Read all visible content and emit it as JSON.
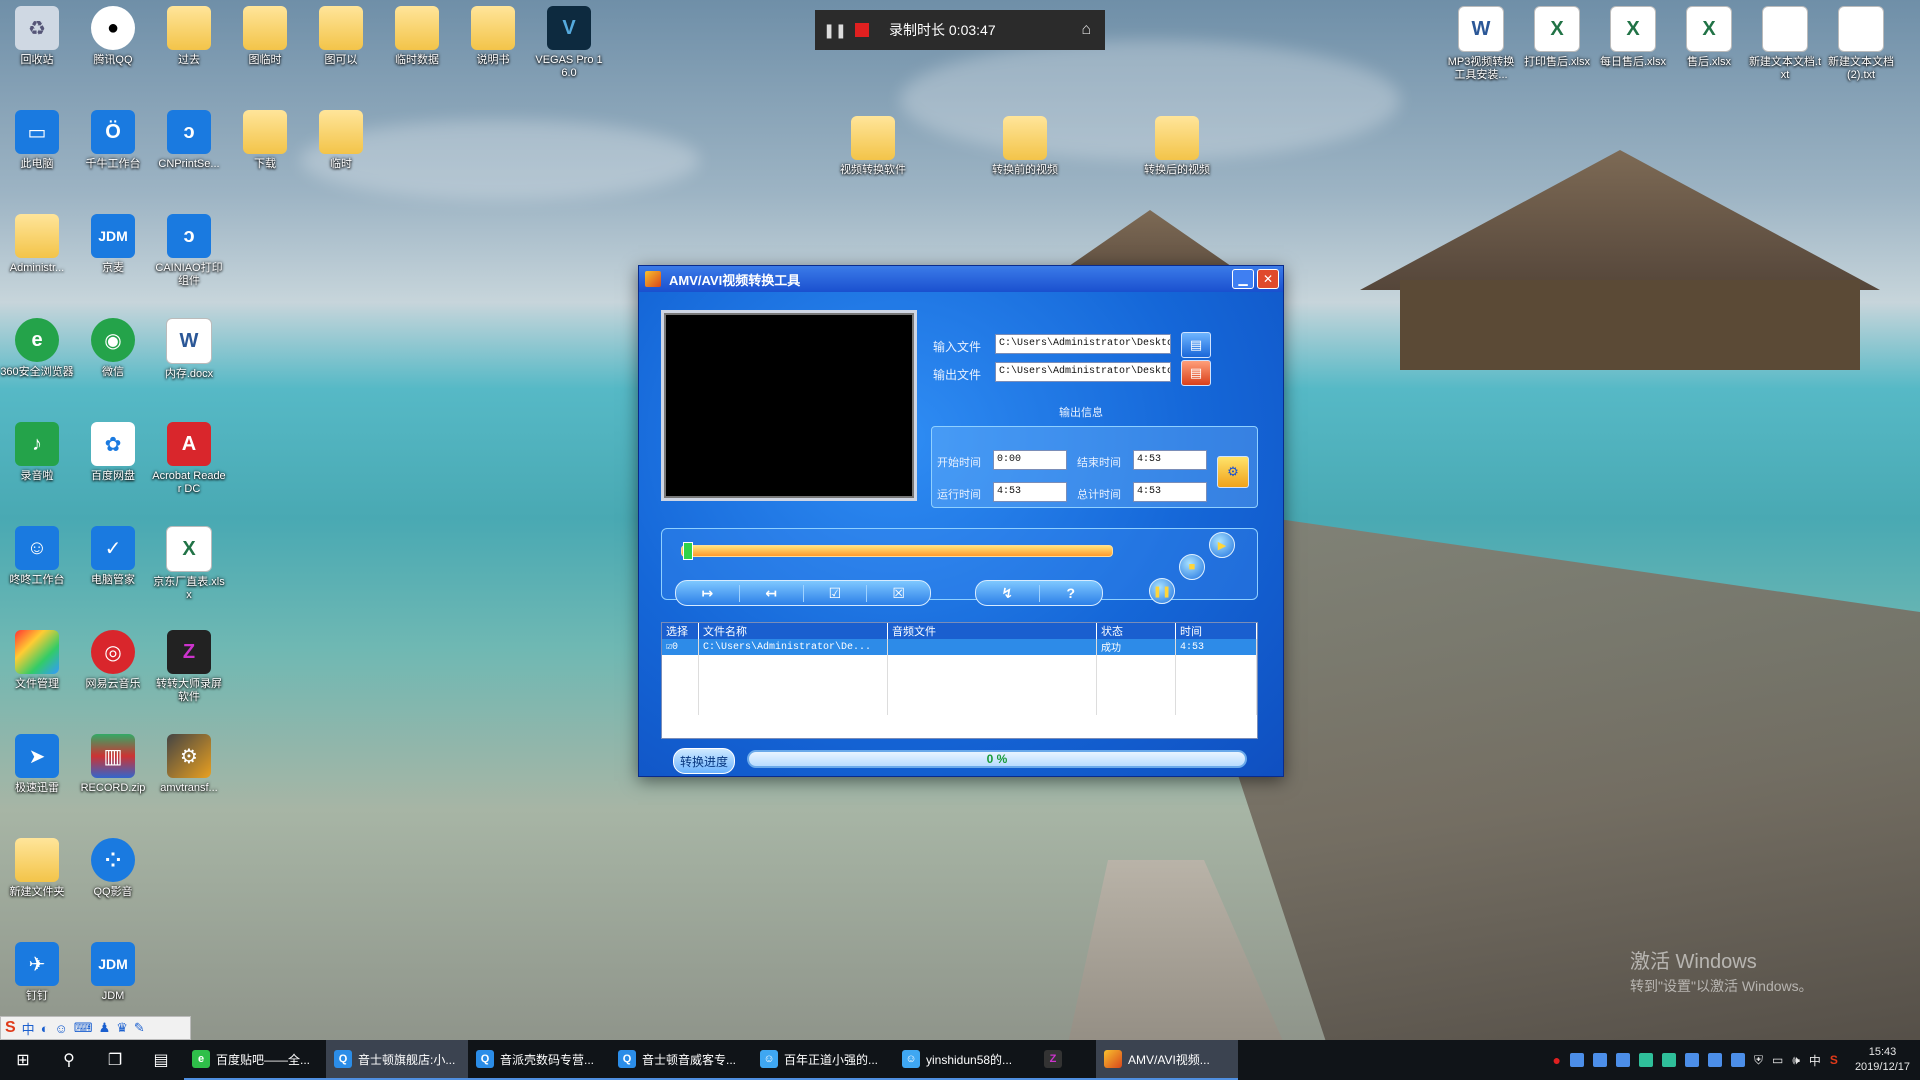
{
  "recording": {
    "label": "录制时长 0:03:47"
  },
  "desktop_icons": [
    "回收站",
    "腾讯QQ",
    "过去",
    "图临时",
    "图可以",
    "临时数据",
    "说明书",
    "VEGAS Pro 16.0",
    "此电脑",
    "千牛工作台",
    "CNPrintSe...",
    "下载",
    "临时",
    "Administr...",
    "京麦",
    "CAINIAO打印组件",
    "360安全浏览器",
    "微信",
    "内存.docx",
    "录音啦",
    "百度网盘",
    "Acrobat Reader DC",
    "咚咚工作台",
    "电脑管家",
    "京东厂直表.xlsx",
    "文件管理",
    "网易云音乐",
    "转转大师录屏软件",
    "极速迅雷",
    "RECORD.zip",
    "amvtransf...",
    "新建文件夹",
    "QQ影音",
    "钉钉",
    "JDM",
    "视频转换软件",
    "转换前的视频",
    "转换后的视频",
    "MP3视频转换工具安装...",
    "打印售后.xlsx",
    "每日售后.xlsx",
    "售后.xlsx",
    "新建文本文档.txt",
    "新建文本文档(2).txt"
  ],
  "window": {
    "title": "AMV/AVI视频转换工具",
    "input_label": "输入文件",
    "input_value": "C:\\Users\\Administrator\\Desktop",
    "output_label": "输出文件",
    "output_value": "C:\\Users\\Administrator\\Desktop",
    "info_title": "输出信息",
    "start_label": "开始时间",
    "start_value": "0:00",
    "end_label": "结束时间",
    "end_value": "4:53",
    "run_label": "运行时间",
    "run_value": "4:53",
    "total_label": "总计时间",
    "total_value": "4:53",
    "list": {
      "headers": [
        "选择",
        "文件名称",
        "音频文件",
        "状态",
        "时间"
      ],
      "rows": [
        {
          "index": "0",
          "file": "C:\\Users\\Administrator\\De...",
          "audio": "",
          "status": "成功",
          "time": "4:53"
        }
      ]
    },
    "progress_label": "转换进度",
    "progress_text": "0 %",
    "progress_value": 0
  },
  "watermark": {
    "line1": "激活 Windows",
    "line2": "转到\"设置\"以激活 Windows。"
  },
  "taskbar": {
    "tasks": [
      "百度贴吧——全...",
      "音士顿旗舰店:小...",
      "音派壳数码专营...",
      "音士顿音威客专...",
      "百年正道小强的...",
      "yinshidun58的...",
      "",
      "AMV/AVI视频..."
    ],
    "ime": "中",
    "time": "15:43",
    "date": "2019/12/17"
  }
}
